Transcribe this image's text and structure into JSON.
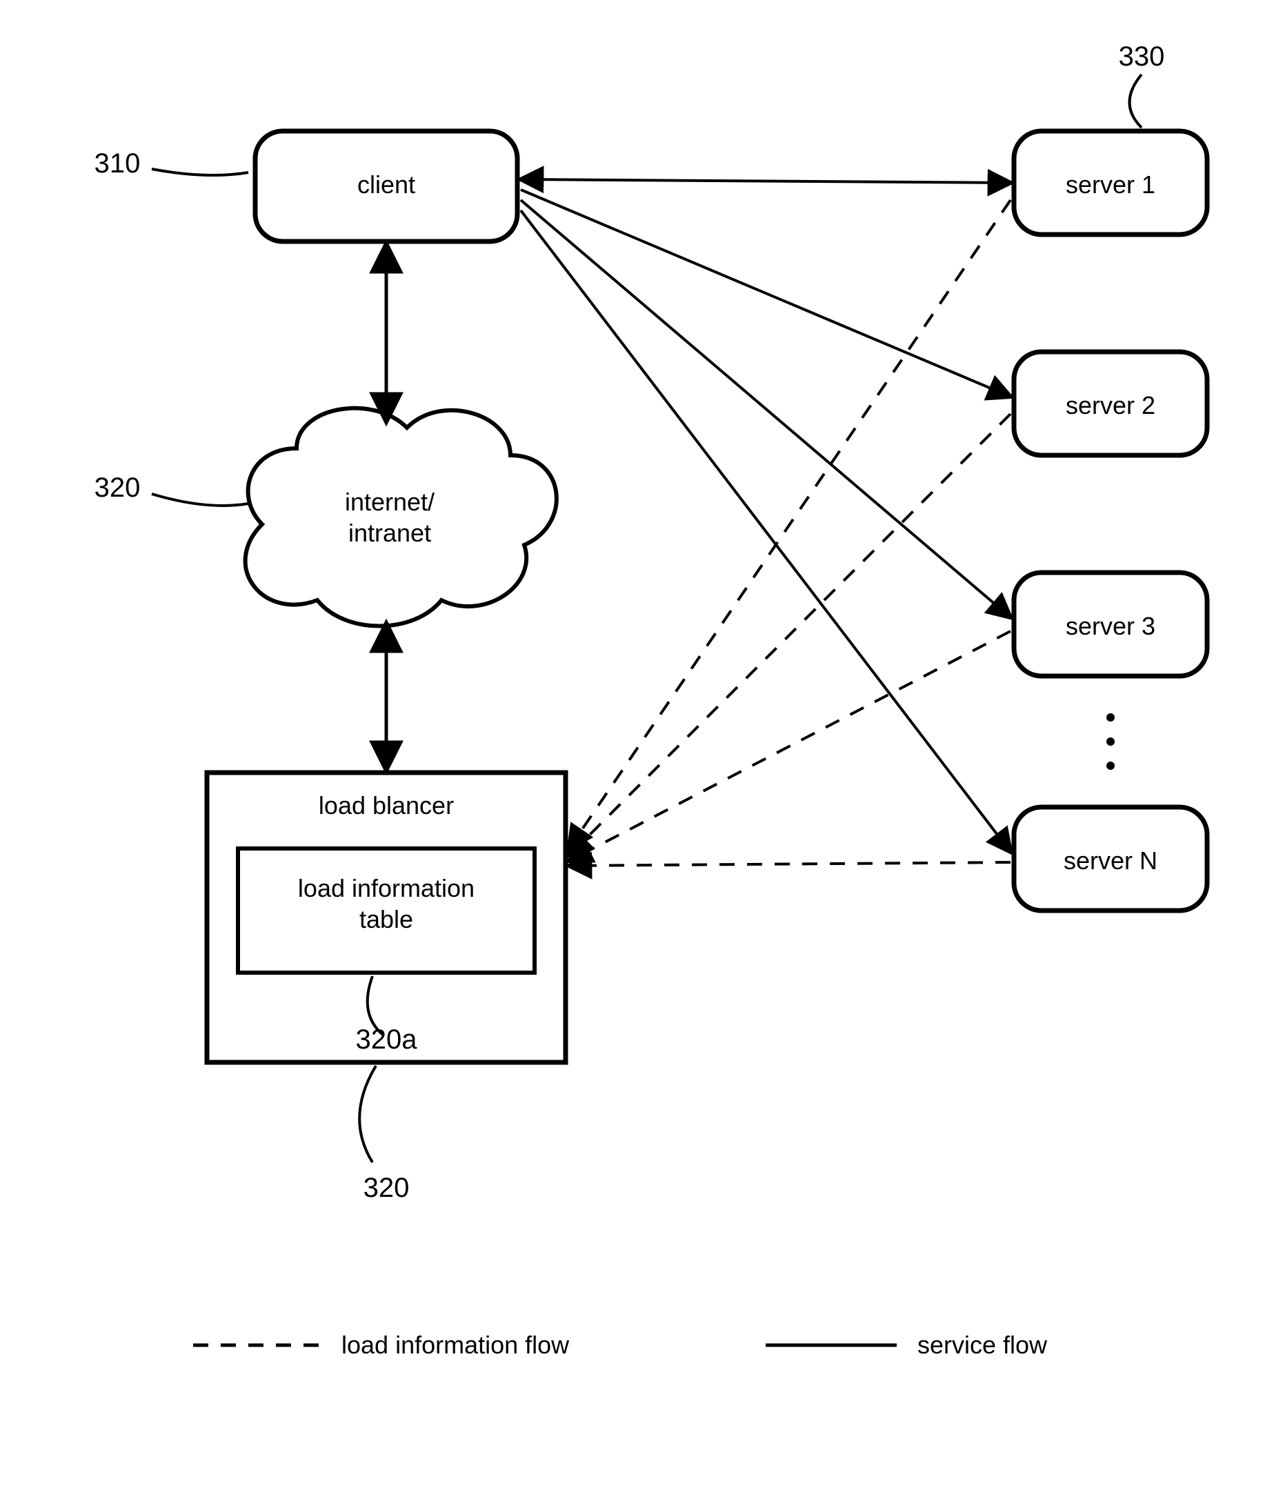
{
  "refs": {
    "client": "310",
    "network": "320",
    "load_balancer": "320",
    "load_table": "320a",
    "servers": "330"
  },
  "nodes": {
    "client": "client",
    "network": "internet/\nintranet",
    "load_balancer": "load blancer",
    "load_table": "load information\ntable",
    "servers": [
      "server 1",
      "server 2",
      "server 3",
      "server N"
    ]
  },
  "ellipsis": "⋮",
  "legend": {
    "dashed": "load information flow",
    "solid": "service flow"
  },
  "chart_data": {
    "type": "diagram",
    "title": "Load balancer architecture",
    "nodes": [
      {
        "id": "client",
        "label": "client",
        "ref": "310"
      },
      {
        "id": "network",
        "label": "internet/intranet",
        "ref": "320"
      },
      {
        "id": "load_balancer",
        "label": "load blancer",
        "ref": "320"
      },
      {
        "id": "load_table",
        "label": "load information table",
        "ref": "320a",
        "parent": "load_balancer"
      },
      {
        "id": "server1",
        "label": "server 1",
        "ref": "330"
      },
      {
        "id": "server2",
        "label": "server 2"
      },
      {
        "id": "server3",
        "label": "server 3"
      },
      {
        "id": "serverN",
        "label": "server N"
      }
    ],
    "edges": [
      {
        "from": "client",
        "to": "network",
        "style": "solid",
        "bidir": true
      },
      {
        "from": "network",
        "to": "load_balancer",
        "style": "solid",
        "bidir": true
      },
      {
        "from": "client",
        "to": "server1",
        "style": "solid",
        "bidir": true
      },
      {
        "from": "client",
        "to": "server2",
        "style": "solid",
        "bidir": false
      },
      {
        "from": "client",
        "to": "server3",
        "style": "solid",
        "bidir": false
      },
      {
        "from": "client",
        "to": "serverN",
        "style": "solid",
        "bidir": false
      },
      {
        "from": "server1",
        "to": "load_balancer",
        "style": "dashed",
        "bidir": false
      },
      {
        "from": "server2",
        "to": "load_balancer",
        "style": "dashed",
        "bidir": false
      },
      {
        "from": "server3",
        "to": "load_balancer",
        "style": "dashed",
        "bidir": false
      },
      {
        "from": "serverN",
        "to": "load_balancer",
        "style": "dashed",
        "bidir": false
      }
    ],
    "legend": [
      {
        "style": "dashed",
        "label": "load information flow"
      },
      {
        "style": "solid",
        "label": "service flow"
      }
    ]
  }
}
